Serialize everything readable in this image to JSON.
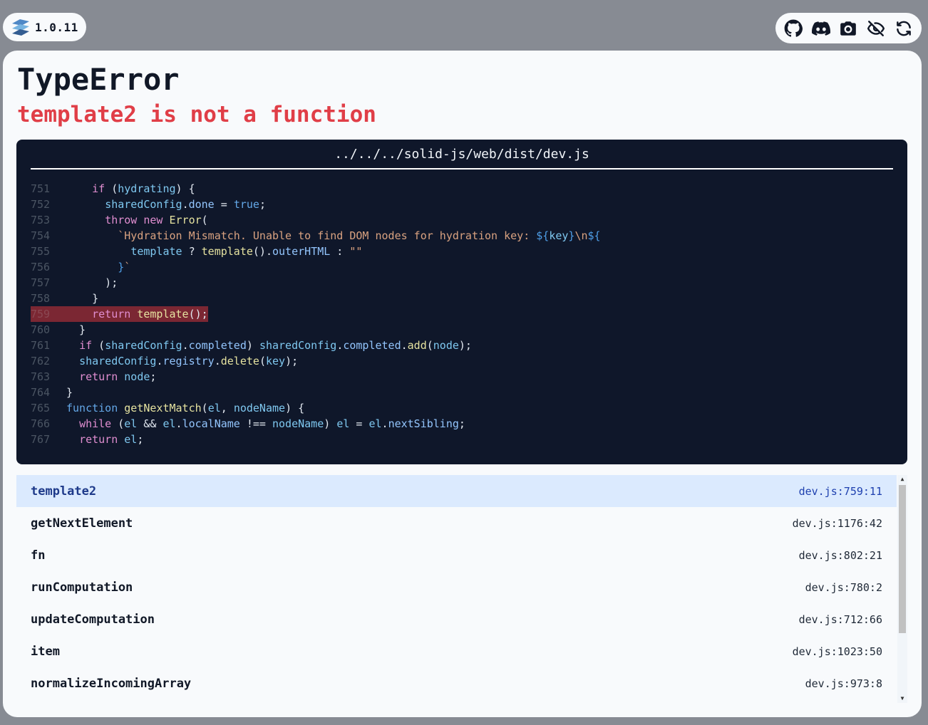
{
  "badge": {
    "version": "1.0.11",
    "logo_icon": "solid-logo-icon"
  },
  "toolbar": {
    "buttons": [
      {
        "name": "github-icon"
      },
      {
        "name": "discord-icon"
      },
      {
        "name": "camera-icon"
      },
      {
        "name": "eye-off-icon"
      },
      {
        "name": "refresh-icon"
      }
    ]
  },
  "error": {
    "type": "TypeError",
    "message": "template2 is not a function"
  },
  "code": {
    "file": "../../../solid-js/web/dist/dev.js",
    "highlight_line": "759",
    "lines": [
      {
        "num": "751",
        "text": "    if (hydrating) {"
      },
      {
        "num": "752",
        "text": "      sharedConfig.done = true;"
      },
      {
        "num": "753",
        "text": "      throw new Error("
      },
      {
        "num": "754",
        "text": "        `Hydration Mismatch. Unable to find DOM nodes for hydration key: ${key}\\n${"
      },
      {
        "num": "755",
        "text": "          template ? template().outerHTML : \"\""
      },
      {
        "num": "756",
        "text": "        }`"
      },
      {
        "num": "757",
        "text": "      );"
      },
      {
        "num": "758",
        "text": "    }"
      },
      {
        "num": "759",
        "text": "    return template();"
      },
      {
        "num": "760",
        "text": "  }"
      },
      {
        "num": "761",
        "text": "  if (sharedConfig.completed) sharedConfig.completed.add(node);"
      },
      {
        "num": "762",
        "text": "  sharedConfig.registry.delete(key);"
      },
      {
        "num": "763",
        "text": "  return node;"
      },
      {
        "num": "764",
        "text": "}"
      },
      {
        "num": "765",
        "text": "function getNextMatch(el, nodeName) {"
      },
      {
        "num": "766",
        "text": "  while (el && el.localName !== nodeName) el = el.nextSibling;"
      },
      {
        "num": "767",
        "text": "  return el;"
      }
    ]
  },
  "stack": {
    "frames": [
      {
        "name": "template2",
        "location": "dev.js:759:11"
      },
      {
        "name": "getNextElement",
        "location": "dev.js:1176:42"
      },
      {
        "name": "fn",
        "location": "dev.js:802:21"
      },
      {
        "name": "runComputation",
        "location": "dev.js:780:2"
      },
      {
        "name": "updateComputation",
        "location": "dev.js:712:66"
      },
      {
        "name": "item",
        "location": "dev.js:1023:50"
      },
      {
        "name": "normalizeIncomingArray",
        "location": "dev.js:973:8"
      }
    ]
  }
}
